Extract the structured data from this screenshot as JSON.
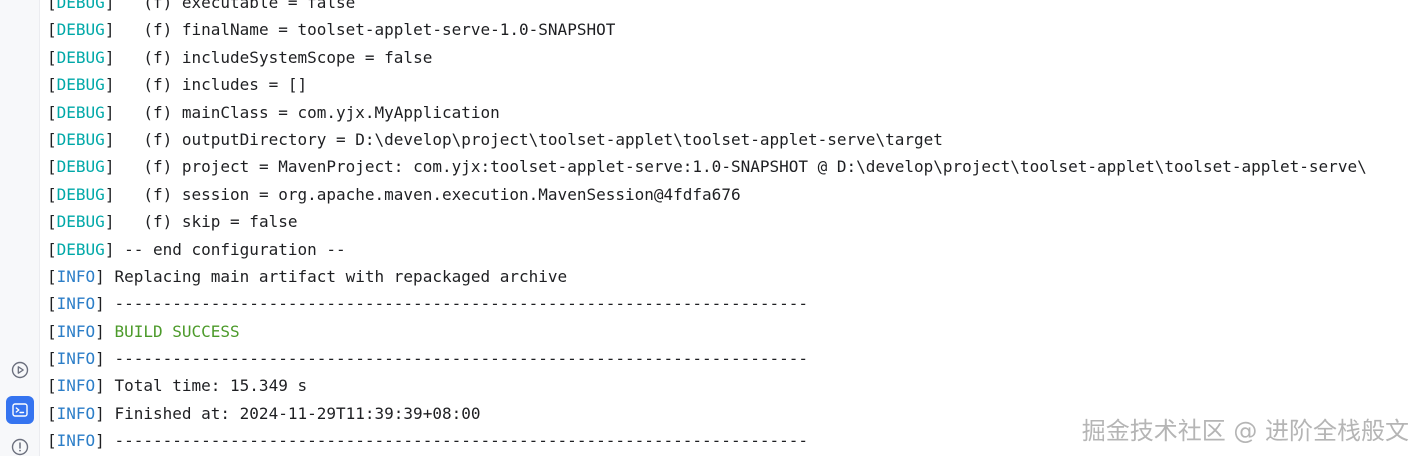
{
  "sidebar": {
    "items": [
      {
        "name": "services",
        "icon": "play-circle-icon"
      },
      {
        "name": "terminal",
        "icon": "terminal-icon",
        "active": true
      },
      {
        "name": "problems",
        "icon": "warning-circle-icon"
      }
    ],
    "active_color": "#3574f0"
  },
  "console": {
    "lines": [
      {
        "level": "DEBUG",
        "text": "  (f) executable = false"
      },
      {
        "level": "DEBUG",
        "text": "  (f) finalName = toolset-applet-serve-1.0-SNAPSHOT"
      },
      {
        "level": "DEBUG",
        "text": "  (f) includeSystemScope = false"
      },
      {
        "level": "DEBUG",
        "text": "  (f) includes = []"
      },
      {
        "level": "DEBUG",
        "text": "  (f) mainClass = com.yjx.MyApplication"
      },
      {
        "level": "DEBUG",
        "text": "  (f) outputDirectory = D:\\develop\\project\\toolset-applet\\toolset-applet-serve\\target"
      },
      {
        "level": "DEBUG",
        "text": "  (f) project = MavenProject: com.yjx:toolset-applet-serve:1.0-SNAPSHOT @ D:\\develop\\project\\toolset-applet\\toolset-applet-serve\\"
      },
      {
        "level": "DEBUG",
        "text": "  (f) session = org.apache.maven.execution.MavenSession@4fdfa676"
      },
      {
        "level": "DEBUG",
        "text": "  (f) skip = false"
      },
      {
        "level": "DEBUG",
        "text": "-- end configuration --"
      },
      {
        "level": "INFO",
        "text": "Replacing main artifact with repackaged archive"
      },
      {
        "level": "INFO",
        "text": "------------------------------------------------------------------------"
      },
      {
        "level": "INFO",
        "text": "BUILD SUCCESS",
        "style": "success"
      },
      {
        "level": "INFO",
        "text": "------------------------------------------------------------------------"
      },
      {
        "level": "INFO",
        "text": "Total time: 15.349 s"
      },
      {
        "level": "INFO",
        "text": "Finished at: 2024-11-29T11:39:39+08:00"
      },
      {
        "level": "INFO",
        "text": "------------------------------------------------------------------------"
      }
    ],
    "colors": {
      "text": "#1e1f22",
      "debug": "#00a8a8",
      "info": "#2c7ec8",
      "success": "#4c9a2a"
    }
  },
  "watermark": {
    "text": "掘金技术社区 @ 进阶全栈般文"
  }
}
